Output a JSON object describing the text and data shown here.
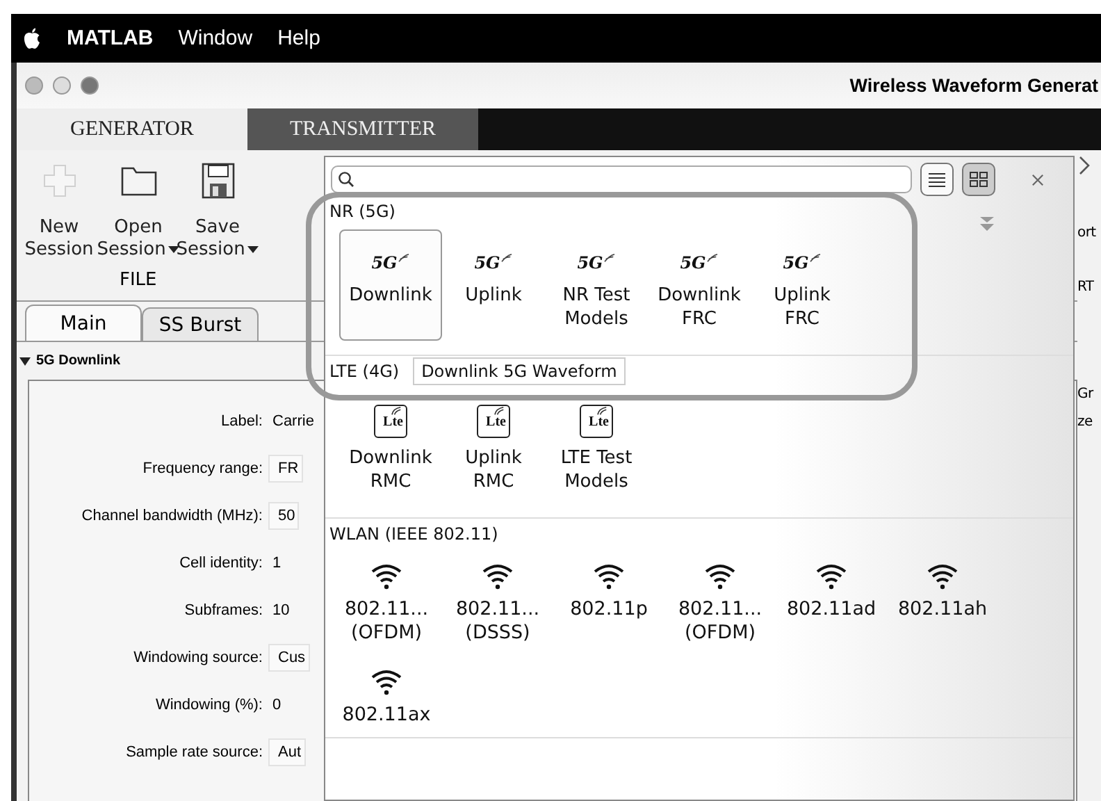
{
  "menubar": {
    "items": [
      "MATLAB",
      "Window",
      "Help"
    ]
  },
  "window": {
    "title": "Wireless Waveform Generat"
  },
  "app_tabs": [
    {
      "label": "GENERATOR",
      "selected": true
    },
    {
      "label": "TRANSMITTER",
      "selected": false
    }
  ],
  "toolstrip": {
    "buttons": [
      {
        "kind": "new",
        "lines": [
          "New",
          "Session"
        ],
        "dropdown": false,
        "disabled": true
      },
      {
        "kind": "open",
        "lines": [
          "Open",
          "Session"
        ],
        "dropdown": true,
        "disabled": false
      },
      {
        "kind": "save",
        "lines": [
          "Save",
          "Session"
        ],
        "dropdown": true,
        "disabled": false
      }
    ],
    "section": "FILE"
  },
  "doc_tabs": [
    {
      "label": "Main",
      "selected": true
    },
    {
      "label": "SS Burst",
      "selected": false
    }
  ],
  "section": {
    "title": "5G Downlink",
    "expanded": true
  },
  "fields": [
    {
      "label": "Label:",
      "value": "Carrie",
      "kind": "text"
    },
    {
      "label": "Frequency range:",
      "value": "FR",
      "kind": "dropdown"
    },
    {
      "label": "Channel bandwidth (MHz):",
      "value": "50",
      "kind": "dropdown"
    },
    {
      "label": "Cell identity:",
      "value": "1",
      "kind": "text"
    },
    {
      "label": "Subframes:",
      "value": "10",
      "kind": "text"
    },
    {
      "label": "Windowing source:",
      "value": "Cus",
      "kind": "dropdown"
    },
    {
      "label": "Windowing (%):",
      "value": "0",
      "kind": "text"
    },
    {
      "label": "Sample rate source:",
      "value": "Aut",
      "kind": "dropdown"
    }
  ],
  "right_edge": {
    "toolstrip_texts": [
      "ort",
      "RT"
    ],
    "panel_texts": [
      "Gr",
      "ze"
    ]
  },
  "gallery": {
    "view_buttons": [
      {
        "kind": "list",
        "selected": false
      },
      {
        "kind": "grid",
        "selected": true
      }
    ],
    "categories": [
      {
        "title": "NR (5G)",
        "kind": "nr",
        "highlighted": true,
        "items": [
          {
            "badge": "5G",
            "lines": [
              "Downlink"
            ],
            "selected": true
          },
          {
            "badge": "5G",
            "lines": [
              "Uplink"
            ],
            "selected": false
          },
          {
            "badge": "5G",
            "lines": [
              "NR Test",
              "Models"
            ],
            "selected": false
          },
          {
            "badge": "5G",
            "lines": [
              "Downlink",
              "FRC"
            ],
            "selected": false
          },
          {
            "badge": "5G",
            "lines": [
              "Uplink",
              "FRC"
            ],
            "selected": false
          }
        ]
      },
      {
        "title": "LTE (4G)",
        "kind": "lte",
        "highlighted": false,
        "tooltip": "Downlink 5G Waveform",
        "items": [
          {
            "badge": "Lte",
            "lines": [
              "Downlink",
              "RMC"
            ],
            "selected": false
          },
          {
            "badge": "Lte",
            "lines": [
              "Uplink",
              "RMC"
            ],
            "selected": false
          },
          {
            "badge": "Lte",
            "lines": [
              "LTE Test",
              "Models"
            ],
            "selected": false
          }
        ]
      },
      {
        "title": "WLAN (IEEE 802.11)",
        "kind": "wlan",
        "highlighted": false,
        "items": [
          {
            "lines": [
              "802.11...",
              "(OFDM)"
            ],
            "selected": false
          },
          {
            "lines": [
              "802.11...",
              "(DSSS)"
            ],
            "selected": false
          },
          {
            "lines": [
              "802.11p"
            ],
            "selected": false
          },
          {
            "lines": [
              "802.11...",
              "(OFDM)"
            ],
            "selected": false
          },
          {
            "lines": [
              "802.11ad"
            ],
            "selected": false
          },
          {
            "lines": [
              "802.11ah"
            ],
            "selected": false
          },
          {
            "lines": [
              "802.11ax"
            ],
            "selected": false
          }
        ]
      }
    ]
  }
}
